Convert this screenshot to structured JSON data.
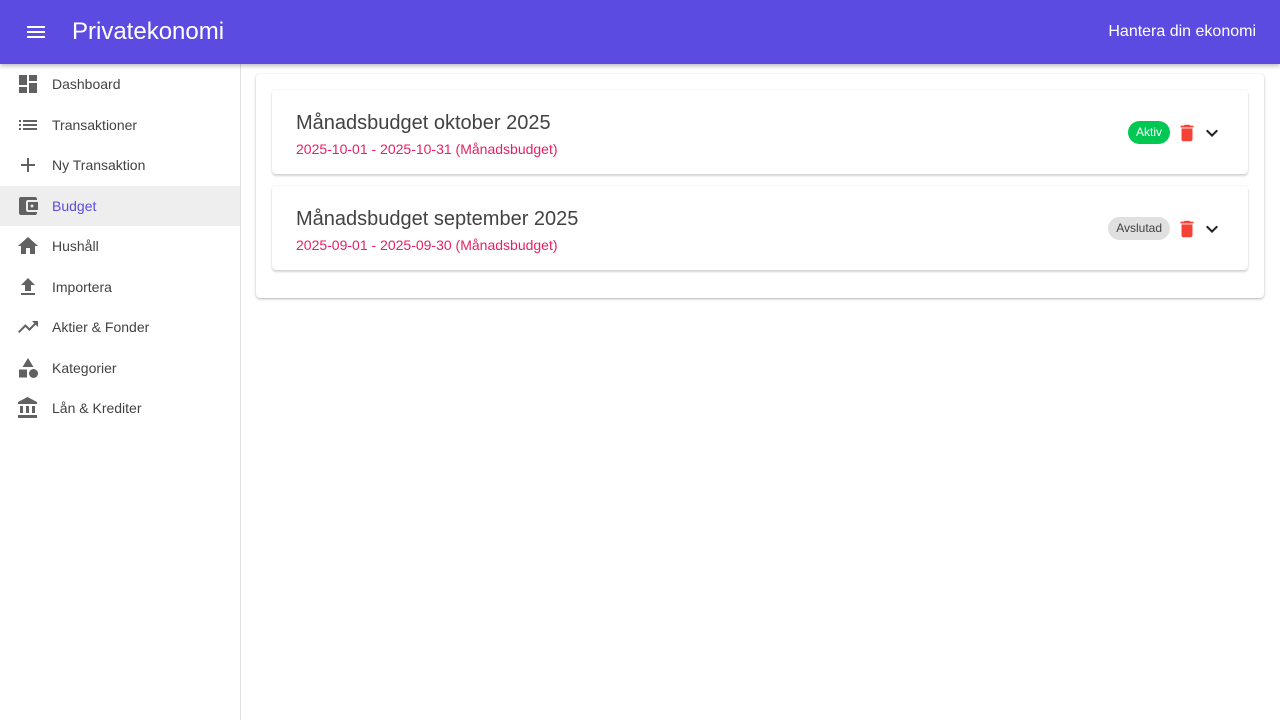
{
  "app": {
    "title": "Privatekonomi",
    "tagline": "Hantera din ekonomi",
    "brand_color": "#5c4be0",
    "menu_icon": "menu-icon"
  },
  "sidebar": {
    "items": [
      {
        "label": "Dashboard",
        "icon": "dashboard-icon",
        "active": false
      },
      {
        "label": "Transaktioner",
        "icon": "list-icon",
        "active": false
      },
      {
        "label": "Ny Transaktion",
        "icon": "plus-icon",
        "active": false
      },
      {
        "label": "Budget",
        "icon": "wallet-icon",
        "active": true
      },
      {
        "label": "Hushåll",
        "icon": "home-icon",
        "active": false
      },
      {
        "label": "Importera",
        "icon": "upload-icon",
        "active": false
      },
      {
        "label": "Aktier & Fonder",
        "icon": "trending-up-icon",
        "active": false
      },
      {
        "label": "Kategorier",
        "icon": "category-icon",
        "active": false
      },
      {
        "label": "Lån & Krediter",
        "icon": "bank-icon",
        "active": false
      }
    ]
  },
  "budgets": [
    {
      "title": "Månadsbudget oktober 2025",
      "subtitle": "2025-10-01 - 2025-10-31 (Månadsbudget)",
      "status": "Aktiv",
      "status_color": "#00c853"
    },
    {
      "title": "Månadsbudget september 2025",
      "subtitle": "2025-09-01 - 2025-09-30 (Månadsbudget)",
      "status": "Avslutad",
      "status_color": "#e0e0e0"
    }
  ],
  "colors": {
    "subtitle": "#e91e63",
    "delete": "#f44336"
  }
}
